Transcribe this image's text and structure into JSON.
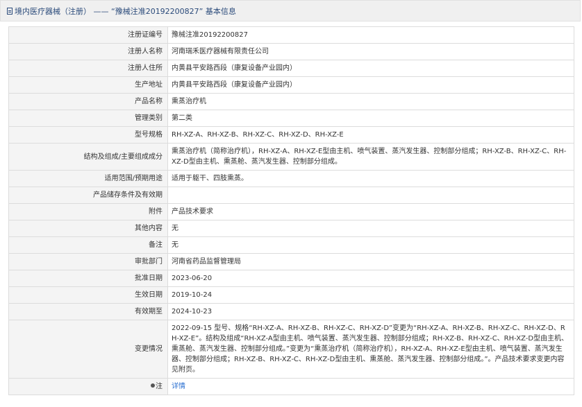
{
  "header": {
    "title": "境内医疗器械（注册） —— “豫械注准20192200827” 基本信息"
  },
  "rows": [
    {
      "label": "注册证编号",
      "value": "豫械注准20192200827"
    },
    {
      "label": "注册人名称",
      "value": "河南瑞禾医疗器械有限责任公司"
    },
    {
      "label": "注册人住所",
      "value": "内黄县平安路西段（康复设备产业园内）"
    },
    {
      "label": "生产地址",
      "value": "内黄县平安路西段（康复设备产业园内）"
    },
    {
      "label": "产品名称",
      "value": "熏蒸治疗机"
    },
    {
      "label": "管理类别",
      "value": "第二类"
    },
    {
      "label": "型号规格",
      "value": "RH-XZ-A、RH-XZ-B、RH-XZ-C、RH-XZ-D、RH-XZ-E"
    },
    {
      "label": "结构及组成/主要组成成分",
      "value": "熏蒸治疗机（简称治疗机），RH-XZ-A、RH-XZ-E型由主机、喷气装置、蒸汽发生器、控制部分组成；RH-XZ-B、RH-XZ-C、RH-XZ-D型由主机、熏蒸舱、蒸汽发生器、控制部分组成。"
    },
    {
      "label": "适用范围/预期用途",
      "value": "适用于躯干、四肢熏蒸。"
    },
    {
      "label": "产品储存条件及有效期",
      "value": ""
    },
    {
      "label": "附件",
      "value": "产品技术要求"
    },
    {
      "label": "其他内容",
      "value": "无"
    },
    {
      "label": "备注",
      "value": "无"
    },
    {
      "label": "审批部门",
      "value": "河南省药品监督管理局"
    },
    {
      "label": "批准日期",
      "value": "2023-06-20"
    },
    {
      "label": "生效日期",
      "value": "2019-10-24"
    },
    {
      "label": "有效期至",
      "value": "2024-10-23"
    },
    {
      "label": "变更情况",
      "value": "2022-09-15 型号、规格“RH-XZ-A、RH-XZ-B、RH-XZ-C、RH-XZ-D”变更为“RH-XZ-A、RH-XZ-B、RH-XZ-C、RH-XZ-D、RH-XZ-E”。结构及组成“RH-XZ-A型由主机、喷气装置、蒸汽发生器、控制部分组成；RH-XZ-B、RH-XZ-C、RH-XZ-D型由主机、熏蒸舱、蒸汽发生器、控制部分组成。”变更为“熏蒸治疗机（简称治疗机），RH-XZ-A、RH-XZ-E型由主机、喷气装置、蒸汽发生器、控制部分组成；RH-XZ-B、RH-XZ-C、RH-XZ-D型由主机、熏蒸舱、蒸汽发生器、控制部分组成。”。产品技术要求变更内容见附页。"
    }
  ],
  "footer_row": {
    "label": "注",
    "value": "详情"
  }
}
